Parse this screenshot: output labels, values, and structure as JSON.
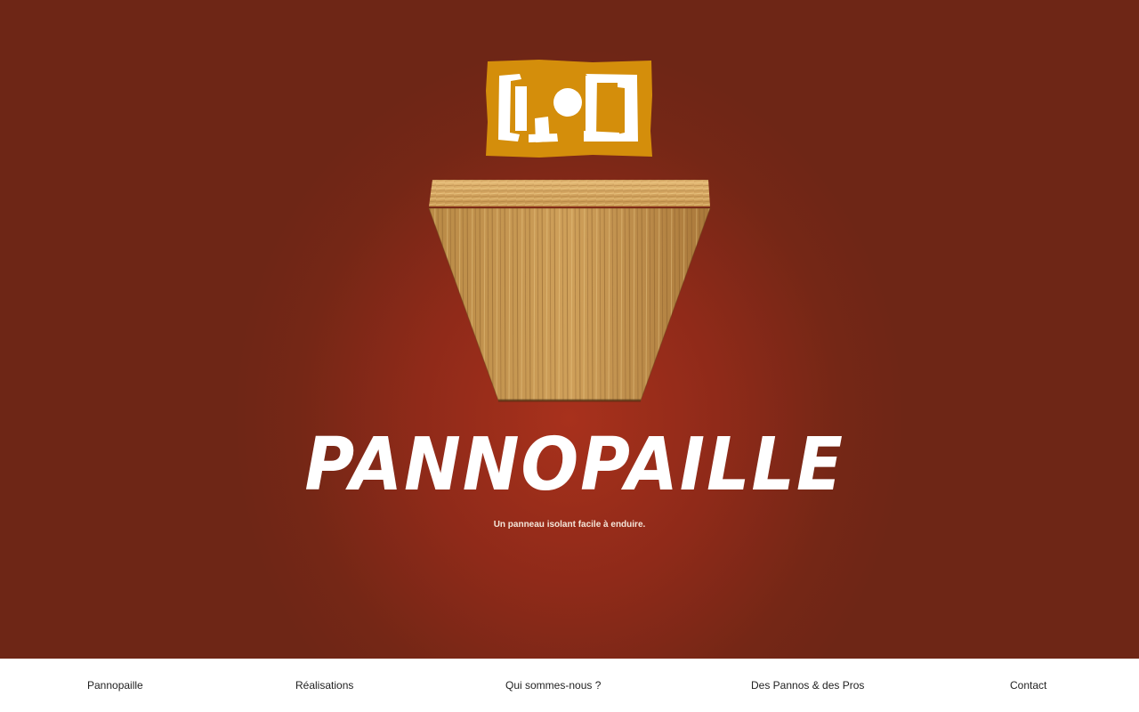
{
  "brand": {
    "logo_icon": "pannopaille-logo-icon",
    "logo_color": "#d48e0b",
    "wordmark": "PANNOPAILLE",
    "tagline": "Un panneau isolant facile à enduire.",
    "background_color": "#8f2a19"
  },
  "hero_image": "straw-bale-panel",
  "nav": {
    "items": [
      {
        "label": "Pannopaille"
      },
      {
        "label": "Réalisations"
      },
      {
        "label": "Qui sommes-nous ?"
      },
      {
        "label": "Des Pannos & des Pros"
      },
      {
        "label": "Contact"
      }
    ]
  }
}
